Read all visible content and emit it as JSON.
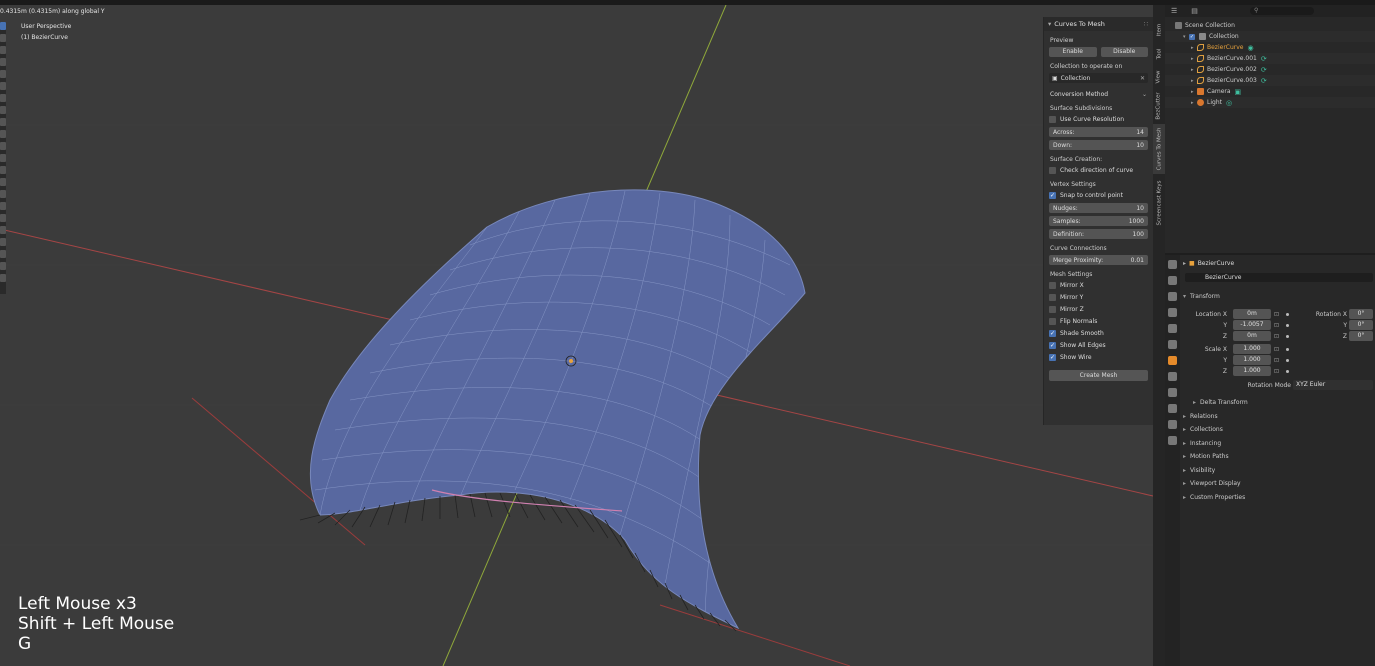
{
  "viewport": {
    "status_text": "0.4315m (0.4315m) along global Y",
    "perspective_label": "User Perspective",
    "object_label": "(1) BezierCurve",
    "screencast_keys": [
      "Left Mouse x3",
      "Shift + Left Mouse",
      "G"
    ]
  },
  "npanel": {
    "title": "Curves To Mesh",
    "preview_label": "Preview",
    "enable_label": "Enable",
    "disable_label": "Disable",
    "collection_label": "Collection to operate on",
    "collection_value": "Collection",
    "conversion_method": "Conversion Method",
    "surface_subdivisions_label": "Surface Subdivisions",
    "use_curve_resolution": "Use Curve Resolution",
    "across_label": "Across:",
    "across_value": "14",
    "down_label": "Down:",
    "down_value": "10",
    "surface_creation_label": "Surface Creation:",
    "check_direction": "Check direction of curve",
    "vertex_settings_label": "Vertex Settings",
    "snap_to_control": "Snap to control point",
    "nudges_label": "Nudges:",
    "nudges_value": "10",
    "samples_label": "Samples:",
    "samples_value": "1000",
    "definition_label": "Definition:",
    "definition_value": "100",
    "curve_connections_label": "Curve Connections",
    "merge_proximity_label": "Merge Proximity:",
    "merge_proximity_value": "0.01",
    "mesh_settings_label": "Mesh Settings",
    "mirror_x": "Mirror X",
    "mirror_y": "Mirror Y",
    "mirror_z": "Mirror Z",
    "flip_normals": "Flip Normals",
    "shade_smooth": "Shade Smooth",
    "show_all_edges": "Show All Edges",
    "show_wire": "Show Wire",
    "create_mesh": "Create Mesh"
  },
  "vtabs": [
    "Item",
    "Tool",
    "View",
    "BezCutter",
    "Curves To Mesh",
    "Screencast Keys"
  ],
  "outliner": {
    "search_placeholder": "",
    "items": [
      {
        "name": "Scene Collection",
        "color": "#cccccc"
      },
      {
        "name": "Collection",
        "color": "#cccccc"
      },
      {
        "name": "BezierCurve",
        "color": "#e8a23c"
      },
      {
        "name": "BezierCurve.001",
        "color": "#cccccc"
      },
      {
        "name": "BezierCurve.002",
        "color": "#cccccc"
      },
      {
        "name": "BezierCurve.003",
        "color": "#cccccc"
      },
      {
        "name": "Camera",
        "color": "#cccccc"
      },
      {
        "name": "Light",
        "color": "#cccccc"
      }
    ]
  },
  "properties": {
    "header_object": "BezierCurve",
    "object_name": "BezierCurve",
    "transform_label": "Transform",
    "location_x_label": "Location X",
    "location_y_label": "Y",
    "location_z_label": "Z",
    "location_x": "0m",
    "location_y": "-1.0057",
    "location_z": "0m",
    "rotation_x_label": "Rotation X",
    "rotation_y_label": "Y",
    "rotation_z_label": "Z",
    "rotation_x": "0°",
    "rotation_y": "0°",
    "rotation_z": "0°",
    "scale_x_label": "Scale X",
    "scale_y_label": "Y",
    "scale_z_label": "Z",
    "scale_x": "1.000",
    "scale_y": "1.000",
    "scale_z": "1.000",
    "rotation_mode_label": "Rotation Mode",
    "rotation_mode_value": "XYZ Euler",
    "delta_transform": "Delta Transform",
    "subpanels": [
      "Relations",
      "Collections",
      "Instancing",
      "Motion Paths",
      "Visibility",
      "Viewport Display",
      "Custom Properties"
    ]
  },
  "colors": {
    "accent": "#4772b3",
    "active_object": "#e8a23c",
    "mesh_fill": "#5a6aa0",
    "axis_x": "#b04848",
    "axis_y": "#8fa83a"
  }
}
